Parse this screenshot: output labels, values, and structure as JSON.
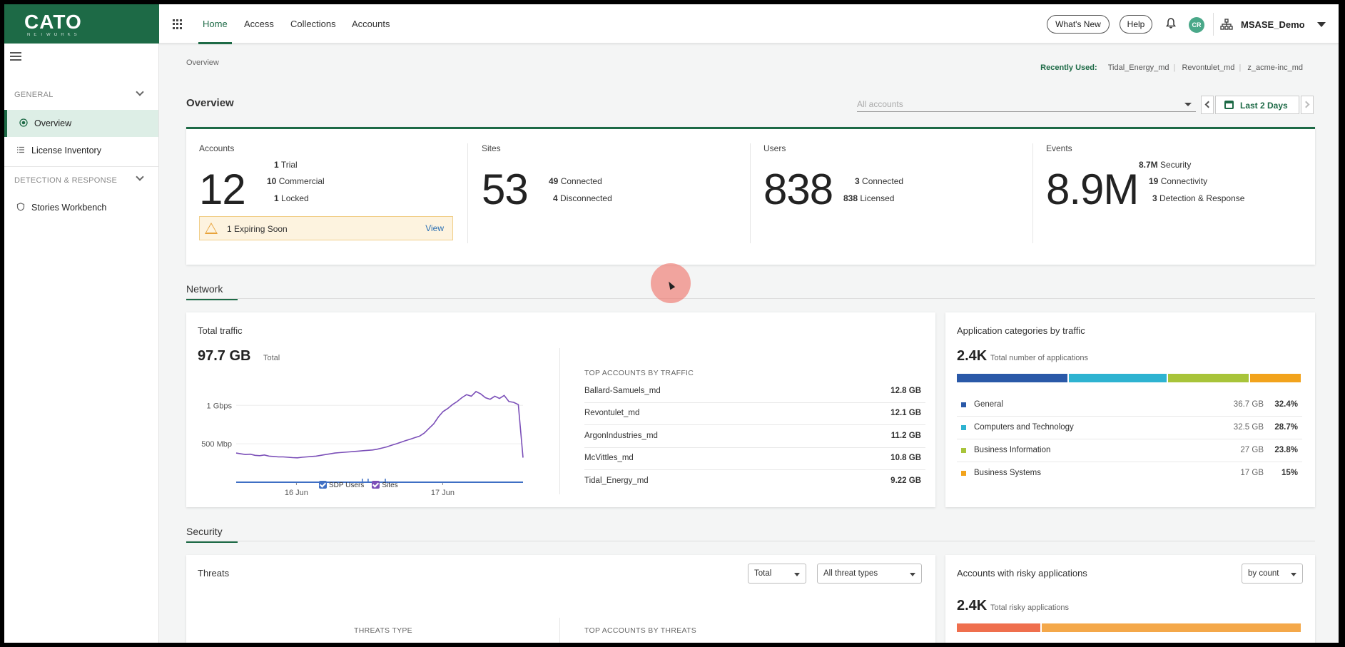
{
  "brand": {
    "logo": "CATO",
    "sub": "NETWORKS"
  },
  "nav": {
    "tabs": [
      "Home",
      "Access",
      "Collections",
      "Accounts"
    ],
    "active": "Home"
  },
  "header": {
    "whats_new": "What's New",
    "help": "Help",
    "avatar_initials": "CR",
    "account": "MSASE_Demo"
  },
  "sidebar": {
    "section_general": "GENERAL",
    "items_general": [
      "Overview",
      "License Inventory"
    ],
    "section_detection": "DETECTION & RESPONSE",
    "items_detection": [
      "Stories Workbench"
    ]
  },
  "breadcrumb": "Overview",
  "recent": {
    "label": "Recently Used:",
    "items": [
      "Tidal_Energy_md",
      "Revontulet_md",
      "z_acme-inc_md"
    ]
  },
  "page_title": "Overview",
  "filters": {
    "account_placeholder": "All accounts",
    "date_range": "Last 2 Days"
  },
  "stats": {
    "accounts": {
      "label": "Accounts",
      "value": "12",
      "breakdown": [
        {
          "n": "1",
          "t": "Trial"
        },
        {
          "n": "10",
          "t": "Commercial"
        },
        {
          "n": "1",
          "t": "Locked"
        }
      ],
      "alert": "1 Expiring Soon",
      "alert_action": "View"
    },
    "sites": {
      "label": "Sites",
      "value": "53",
      "breakdown": [
        {
          "n": "49",
          "t": "Connected"
        },
        {
          "n": "4",
          "t": "Disconnected"
        }
      ]
    },
    "users": {
      "label": "Users",
      "value": "838",
      "breakdown": [
        {
          "n": "3",
          "t": "Connected"
        },
        {
          "n": "838",
          "t": "Licensed"
        }
      ]
    },
    "events": {
      "label": "Events",
      "value": "8.9M",
      "breakdown": [
        {
          "n": "8.7M",
          "t": "Security"
        },
        {
          "n": "19",
          "t": "Connectivity"
        },
        {
          "n": "3",
          "t": "Detection & Response"
        }
      ]
    }
  },
  "network": {
    "section": "Network",
    "traffic": {
      "title": "Total traffic",
      "total": "97.7 GB",
      "total_label": "Total",
      "top_title": "TOP ACCOUNTS BY TRAFFIC",
      "top": [
        {
          "name": "Ballard-Samuels_md",
          "value": "12.8 GB"
        },
        {
          "name": "Revontulet_md",
          "value": "12.1 GB"
        },
        {
          "name": "ArgonIndustries_md",
          "value": "11.2 GB"
        },
        {
          "name": "McVittles_md",
          "value": "10.8 GB"
        },
        {
          "name": "Tidal_Energy_md",
          "value": "9.22 GB"
        }
      ]
    },
    "categories": {
      "title": "Application categories by traffic",
      "total": "2.4K",
      "total_label": "Total number of applications",
      "items": [
        {
          "name": "General",
          "gb": "36.7 GB",
          "pct": "32.4%",
          "share": 32.4,
          "color": "#2a59a8"
        },
        {
          "name": "Computers and Technology",
          "gb": "32.5 GB",
          "pct": "28.7%",
          "share": 28.7,
          "color": "#2eb3d1"
        },
        {
          "name": "Business Information",
          "gb": "27 GB",
          "pct": "23.8%",
          "share": 23.8,
          "color": "#a8c43a"
        },
        {
          "name": "Business Systems",
          "gb": "17 GB",
          "pct": "15%",
          "share": 15,
          "color": "#f2a31c"
        }
      ]
    }
  },
  "chart_data": {
    "type": "line",
    "title": "",
    "y_ticks": [
      "1 Gbps",
      "500 Mbp"
    ],
    "x_ticks": [
      "16 Jun",
      "17 Jun"
    ],
    "ylim": [
      0,
      1300
    ],
    "legend": [
      {
        "name": "SDP Users",
        "color": "#3f6fc4"
      },
      {
        "name": "Sites",
        "color": "#7b4fb8"
      }
    ],
    "series": [
      {
        "name": "Sites",
        "color": "#7b4fb8",
        "values": [
          380,
          370,
          360,
          365,
          350,
          345,
          355,
          340,
          335,
          330,
          330,
          325,
          320,
          318,
          325,
          330,
          335,
          340,
          350,
          360,
          370,
          380,
          385,
          390,
          395,
          400,
          405,
          410,
          415,
          420,
          430,
          445,
          460,
          480,
          500,
          520,
          540,
          560,
          580,
          600,
          640,
          700,
          760,
          850,
          920,
          960,
          1010,
          1050,
          1100,
          1140,
          1120,
          1180,
          1150,
          1100,
          1080,
          1120,
          1090,
          1130,
          1050,
          1040,
          1010,
          320
        ]
      },
      {
        "name": "SDP Users",
        "color": "#3f6fc4",
        "values": [
          0,
          0,
          0,
          0,
          0,
          0,
          0,
          0,
          0,
          0,
          0,
          0,
          0,
          0,
          0,
          0,
          0,
          0,
          0,
          0,
          0,
          0,
          0,
          0,
          0,
          0,
          0,
          0,
          0,
          0,
          0,
          0,
          0,
          0,
          0,
          0,
          0,
          0,
          0,
          0,
          0,
          0,
          0,
          0,
          0,
          0,
          0,
          0,
          0,
          0,
          0,
          0,
          0,
          0,
          0,
          0,
          0,
          0,
          0,
          0,
          0,
          0
        ]
      }
    ]
  },
  "security": {
    "section": "Security",
    "threats": {
      "title": "Threats",
      "filter_total": "Total",
      "filter_types": "All threat types",
      "type_title": "THREATS TYPE",
      "top_title": "TOP ACCOUNTS BY THREATS"
    },
    "risky": {
      "title": "Accounts with risky applications",
      "filter": "by count",
      "total": "2.4K",
      "total_label": "Total risky applications",
      "bar": [
        {
          "share": 24.5,
          "color": "#ef6f4e"
        },
        {
          "share": 75.5,
          "color": "#f4a84a"
        }
      ]
    }
  }
}
